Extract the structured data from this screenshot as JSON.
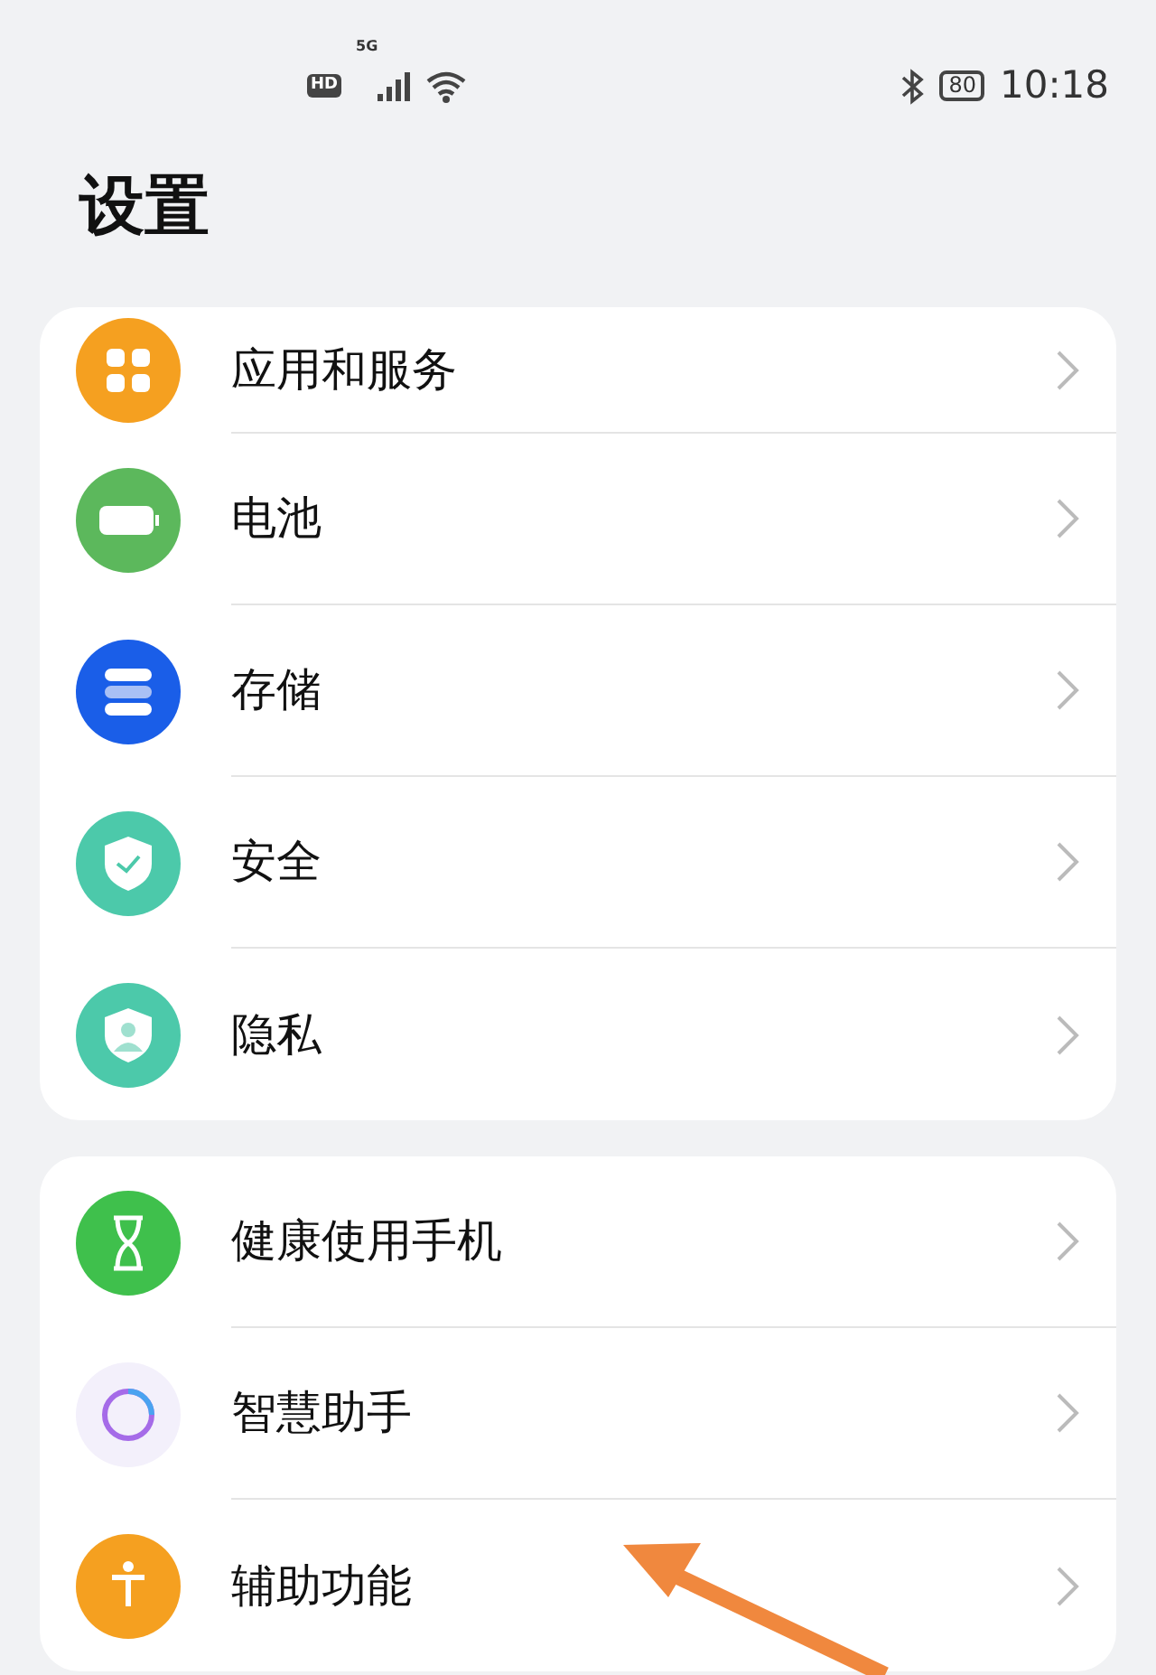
{
  "status_bar": {
    "hd": "HD",
    "network": "5G",
    "battery": "80",
    "time": "10:18"
  },
  "title": "设置",
  "groups": [
    {
      "items": [
        {
          "kind": "apps",
          "label": "应用和服务"
        },
        {
          "kind": "battery",
          "label": "电池"
        },
        {
          "kind": "storage",
          "label": "存储"
        },
        {
          "kind": "security",
          "label": "安全"
        },
        {
          "kind": "privacy",
          "label": "隐私"
        }
      ]
    },
    {
      "items": [
        {
          "kind": "hourglass",
          "label": "健康使用手机"
        },
        {
          "kind": "assistant",
          "label": "智慧助手"
        },
        {
          "kind": "accessibility",
          "label": "辅助功能"
        }
      ]
    }
  ]
}
